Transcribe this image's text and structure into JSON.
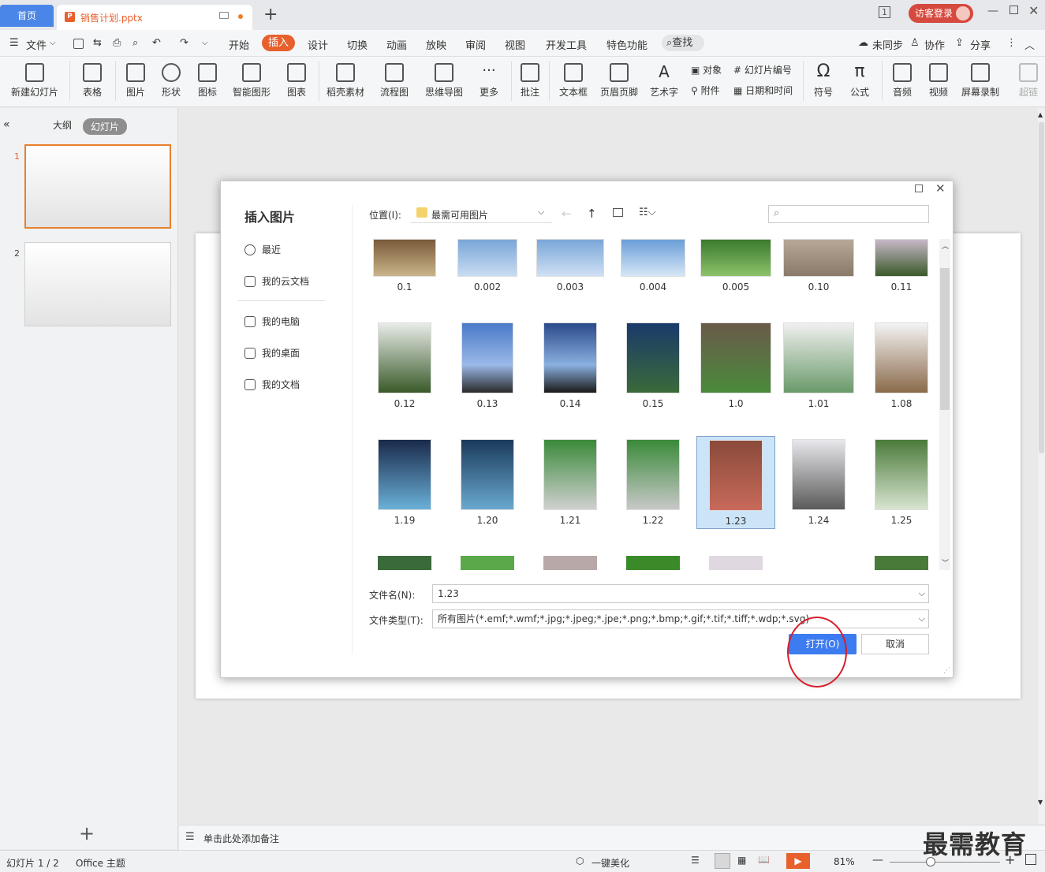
{
  "tabs": {
    "home": "首页",
    "doc": "销售计划.pptx",
    "login": "访客登录"
  },
  "menu": {
    "file": "文件",
    "items": [
      "开始",
      "插入",
      "设计",
      "切换",
      "动画",
      "放映",
      "审阅",
      "视图",
      "开发工具",
      "特色功能"
    ],
    "find": "查找",
    "sync": "未同步",
    "collab": "协作",
    "share": "分享"
  },
  "ribbon": {
    "big": [
      "新建幻灯片",
      "表格",
      "图片",
      "形状",
      "图标",
      "智能图形",
      "图表",
      "稻壳素材",
      "流程图",
      "思维导图",
      "更多",
      "批注",
      "文本框",
      "页眉页脚",
      "艺术字",
      "符号",
      "公式",
      "音频",
      "视频",
      "屏幕录制",
      "超链"
    ],
    "small": {
      "object": "对象",
      "slidenum": "幻灯片编号",
      "attach": "附件",
      "datetime": "日期和时间"
    }
  },
  "leftpane": {
    "tab_outline": "大纲",
    "tab_slides": "幻灯片",
    "slides": [
      "1",
      "2"
    ]
  },
  "dialog": {
    "title": "插入图片",
    "nav": [
      "最近",
      "我的云文档",
      "我的电脑",
      "我的桌面",
      "我的文档"
    ],
    "location_label": "位置(I):",
    "location_value": "最需可用图片",
    "search_placeholder": "",
    "items": [
      "0.1",
      "0.002",
      "0.003",
      "0.004",
      "0.005",
      "0.10",
      "0.11",
      "0.12",
      "0.13",
      "0.14",
      "0.15",
      "1.0",
      "1.01",
      "1.08",
      "1.19",
      "1.20",
      "1.21",
      "1.22",
      "1.23",
      "1.24",
      "1.25"
    ],
    "filename_label": "文件名(N):",
    "filename_value": "1.23",
    "filetype_label": "文件类型(T):",
    "filetype_value": "所有图片(*.emf;*.wmf;*.jpg;*.jpeg;*.jpe;*.png;*.bmp;*.gif;*.tif;*.tiff;*.wdp;*.svg)",
    "open_button": "打开(O)",
    "cancel_button": "取消"
  },
  "notes": "单击此处添加备注",
  "status": {
    "slide": "幻灯片 1 / 2",
    "theme": "Office 主题",
    "beautify": "一键美化",
    "zoom": "81%"
  },
  "watermark": "最需教育"
}
